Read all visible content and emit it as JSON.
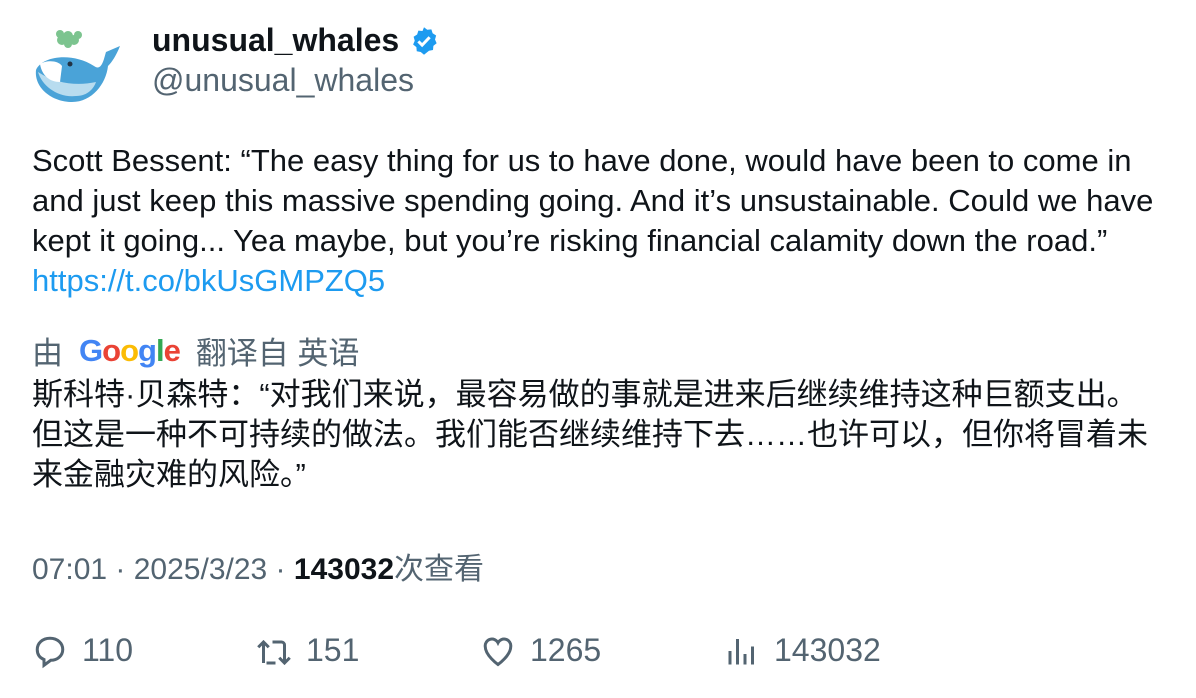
{
  "author": {
    "display_name": "unusual_whales",
    "handle": "@unusual_whales",
    "verified": true,
    "avatar_icon": "whale-logo"
  },
  "tweet": {
    "text": "Scott Bessent: “The easy thing for us to have done, would have been to come in and just keep this massive spending going. And it’s unsustainable. Could we have kept it going... Yea maybe, but you’re risking financial calamity down the road.” ",
    "link": "https://t.co/bkUsGMPZQ5"
  },
  "translation": {
    "prefix": "由",
    "provider": "Google",
    "suffix": "翻译自 英语",
    "text": "斯科特·贝森特：“对我们来说，最容易做的事就是进来后继续维持这种巨额支出。但这是一种不可持续的做法。我们能否继续维持下去……也许可以，但你将冒着未来金融灾难的风险。”"
  },
  "meta": {
    "time": "07:01",
    "date": "2025/3/23",
    "views": "143032",
    "views_label": "次查看",
    "sep": " · "
  },
  "actions": {
    "replies": "110",
    "retweets": "151",
    "likes": "1265",
    "views": "143032"
  },
  "colors": {
    "text": "#0f1419",
    "secondary": "#536471",
    "link": "#1d9bf0",
    "verified": "#1d9bf0"
  }
}
